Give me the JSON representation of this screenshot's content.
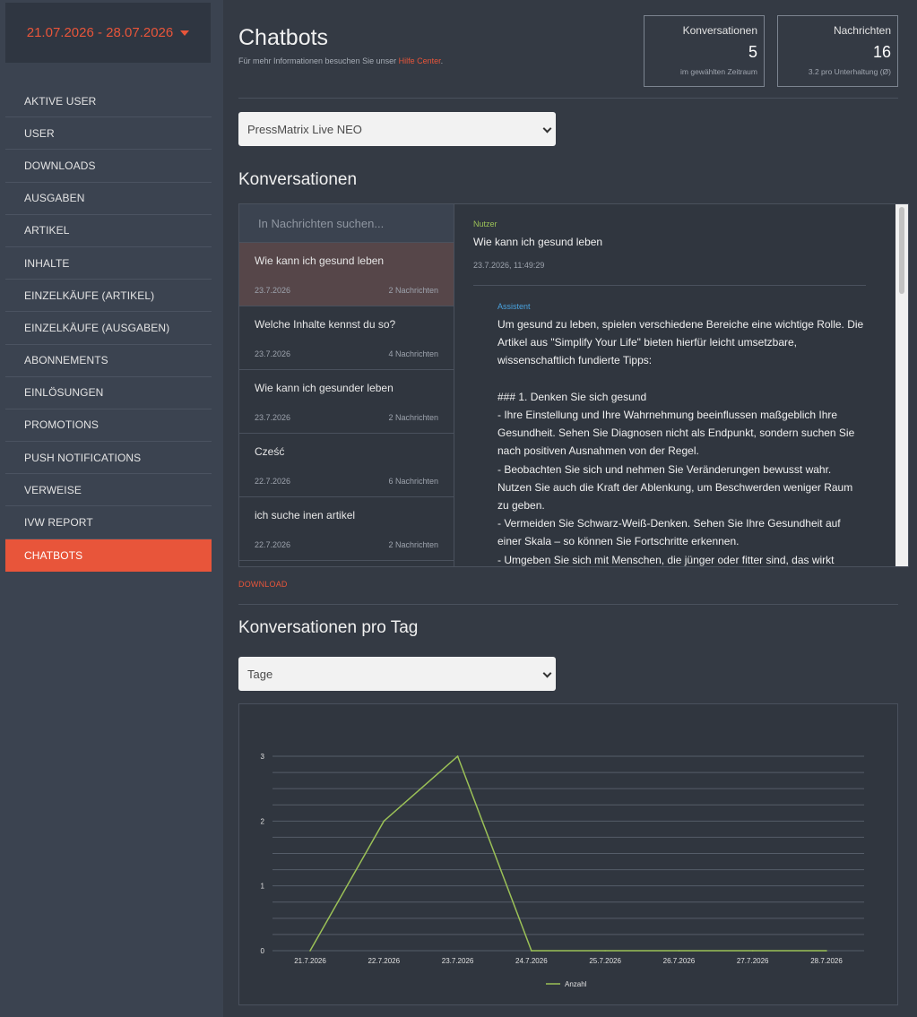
{
  "sidebar": {
    "date_range": "21.07.2026 - 28.07.2026",
    "items": [
      {
        "label": "AKTIVE USER",
        "key": "aktive-user"
      },
      {
        "label": "USER",
        "key": "user"
      },
      {
        "label": "DOWNLOADS",
        "key": "downloads"
      },
      {
        "label": "AUSGABEN",
        "key": "ausgaben"
      },
      {
        "label": "ARTIKEL",
        "key": "artikel"
      },
      {
        "label": "INHALTE",
        "key": "inhalte"
      },
      {
        "label": "EINZELKÄUFE (ARTIKEL)",
        "key": "einzelkaeufe-artikel"
      },
      {
        "label": "EINZELKÄUFE (AUSGABEN)",
        "key": "einzelkaeufe-ausgaben"
      },
      {
        "label": "ABONNEMENTS",
        "key": "abonnements"
      },
      {
        "label": "EINLÖSUNGEN",
        "key": "einloesungen"
      },
      {
        "label": "PROMOTIONS",
        "key": "promotions"
      },
      {
        "label": "PUSH NOTIFICATIONS",
        "key": "push-notifications"
      },
      {
        "label": "VERWEISE",
        "key": "verweise"
      },
      {
        "label": "IVW REPORT",
        "key": "ivw-report"
      },
      {
        "label": "CHATBOTS",
        "key": "chatbots",
        "active": true
      }
    ]
  },
  "header": {
    "title": "Chatbots",
    "subtitle_prefix": "Für mehr Informationen besuchen Sie unser ",
    "subtitle_link": "Hilfe Center",
    "subtitle_suffix": "."
  },
  "stats": {
    "conversations": {
      "label": "Konversationen",
      "value": "5",
      "sub": "im gewählten Zeitraum"
    },
    "messages": {
      "label": "Nachrichten",
      "value": "16",
      "sub": "3.2 pro Unterhaltung (Ø)"
    }
  },
  "bot_select": {
    "value": "PressMatrix Live NEO"
  },
  "conversations": {
    "heading": "Konversationen",
    "search_placeholder": "In Nachrichten suchen...",
    "items": [
      {
        "question": "Wie kann ich gesund leben",
        "date": "23.7.2026",
        "count": "2 Nachrichten",
        "selected": true
      },
      {
        "question": "Welche Inhalte kennst du so?",
        "date": "23.7.2026",
        "count": "4 Nachrichten"
      },
      {
        "question": "Wie kann ich gesunder leben",
        "date": "23.7.2026",
        "count": "2 Nachrichten"
      },
      {
        "question": "Cześć",
        "date": "22.7.2026",
        "count": "6 Nachrichten"
      },
      {
        "question": "ich suche inen artikel",
        "date": "22.7.2026",
        "count": "2 Nachrichten"
      }
    ],
    "detail": {
      "user_label": "Nutzer",
      "user_message": "Wie kann ich gesund leben",
      "user_time": "23.7.2026, 11:49:29",
      "bot_label": "Assistent",
      "bot_message": "Um gesund zu leben, spielen verschiedene Bereiche eine wichtige Rolle. Die Artikel aus \"Simplify Your Life\" bieten hierfür leicht umsetzbare, wissenschaftlich fundierte Tipps:\n\n### 1. Denken Sie sich gesund\n- Ihre Einstellung und Ihre Wahrnehmung beeinflussen maßgeblich Ihre Gesundheit. Sehen Sie Diagnosen nicht als Endpunkt, sondern suchen Sie nach positiven Ausnahmen von der Regel.\n- Beobachten Sie sich und nehmen Sie Veränderungen bewusst wahr. Nutzen Sie auch die Kraft der Ablenkung, um Beschwerden weniger Raum zu geben.\n- Vermeiden Sie Schwarz-Weiß-Denken. Sehen Sie Ihre Gesundheit auf einer Skala – so können Sie Fortschritte erkennen.\n- Umgeben Sie sich mit Menschen, die jünger oder fitter sind, das wirkt"
    },
    "download_label": "DOWNLOAD"
  },
  "per_day": {
    "heading": "Konversationen pro Tag",
    "select_value": "Tage"
  },
  "colors": {
    "accent": "#e8553a",
    "line": "#9bc157",
    "user": "#9bc157",
    "assistant": "#4aa3df"
  },
  "chart_data": {
    "type": "line",
    "categories": [
      "21.7.2026",
      "22.7.2026",
      "23.7.2026",
      "24.7.2026",
      "25.7.2026",
      "26.7.2026",
      "27.7.2026",
      "28.7.2026"
    ],
    "series": [
      {
        "name": "Anzahl",
        "values": [
          0,
          2,
          3,
          0,
          0,
          0,
          0,
          0
        ]
      }
    ],
    "yticks": [
      0,
      1,
      2,
      3
    ],
    "ylim": [
      0,
      3
    ],
    "grid": true,
    "legend": "bottom"
  }
}
